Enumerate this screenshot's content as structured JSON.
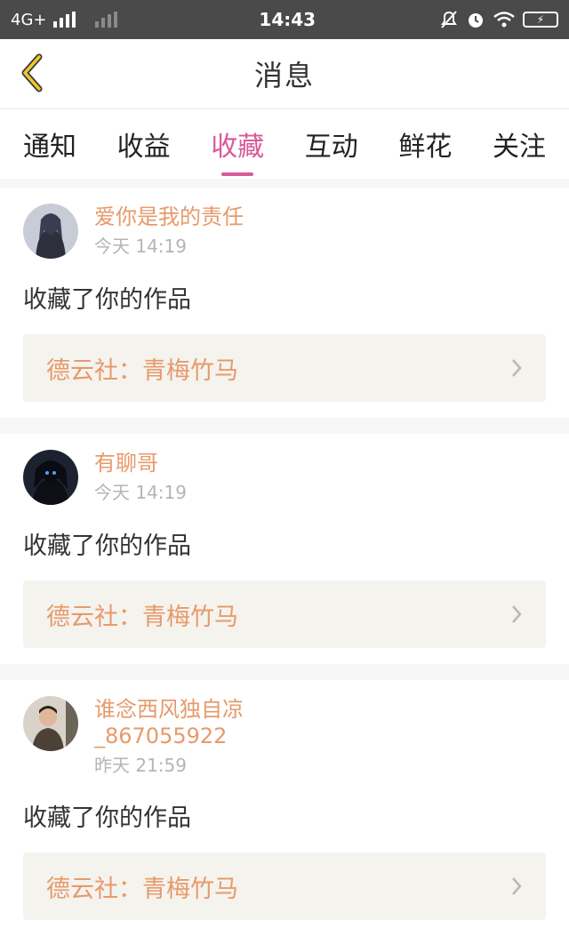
{
  "status": {
    "network": "4G+",
    "time": "14:43"
  },
  "header": {
    "title": "消息"
  },
  "tabs": [
    {
      "label": "通知"
    },
    {
      "label": "收益"
    },
    {
      "label": "收藏"
    },
    {
      "label": "互动"
    },
    {
      "label": "鲜花"
    },
    {
      "label": "关注"
    }
  ],
  "active_tab": "收藏",
  "messages": [
    {
      "user": "爱你是我的责任",
      "time": "今天 14:19",
      "action": "收藏了你的作品",
      "work": "德云社：青梅竹马"
    },
    {
      "user": "有聊哥",
      "time": "今天 14:19",
      "action": "收藏了你的作品",
      "work": "德云社：青梅竹马"
    },
    {
      "user": "谁念西风独自凉\n_867055922",
      "time": "昨天 21:59",
      "action": "收藏了你的作品",
      "work": "德云社：青梅竹马"
    }
  ],
  "colors": {
    "accent": "#d95a9b",
    "username": "#e79a6b",
    "statusbar": "#4a4a4a"
  }
}
